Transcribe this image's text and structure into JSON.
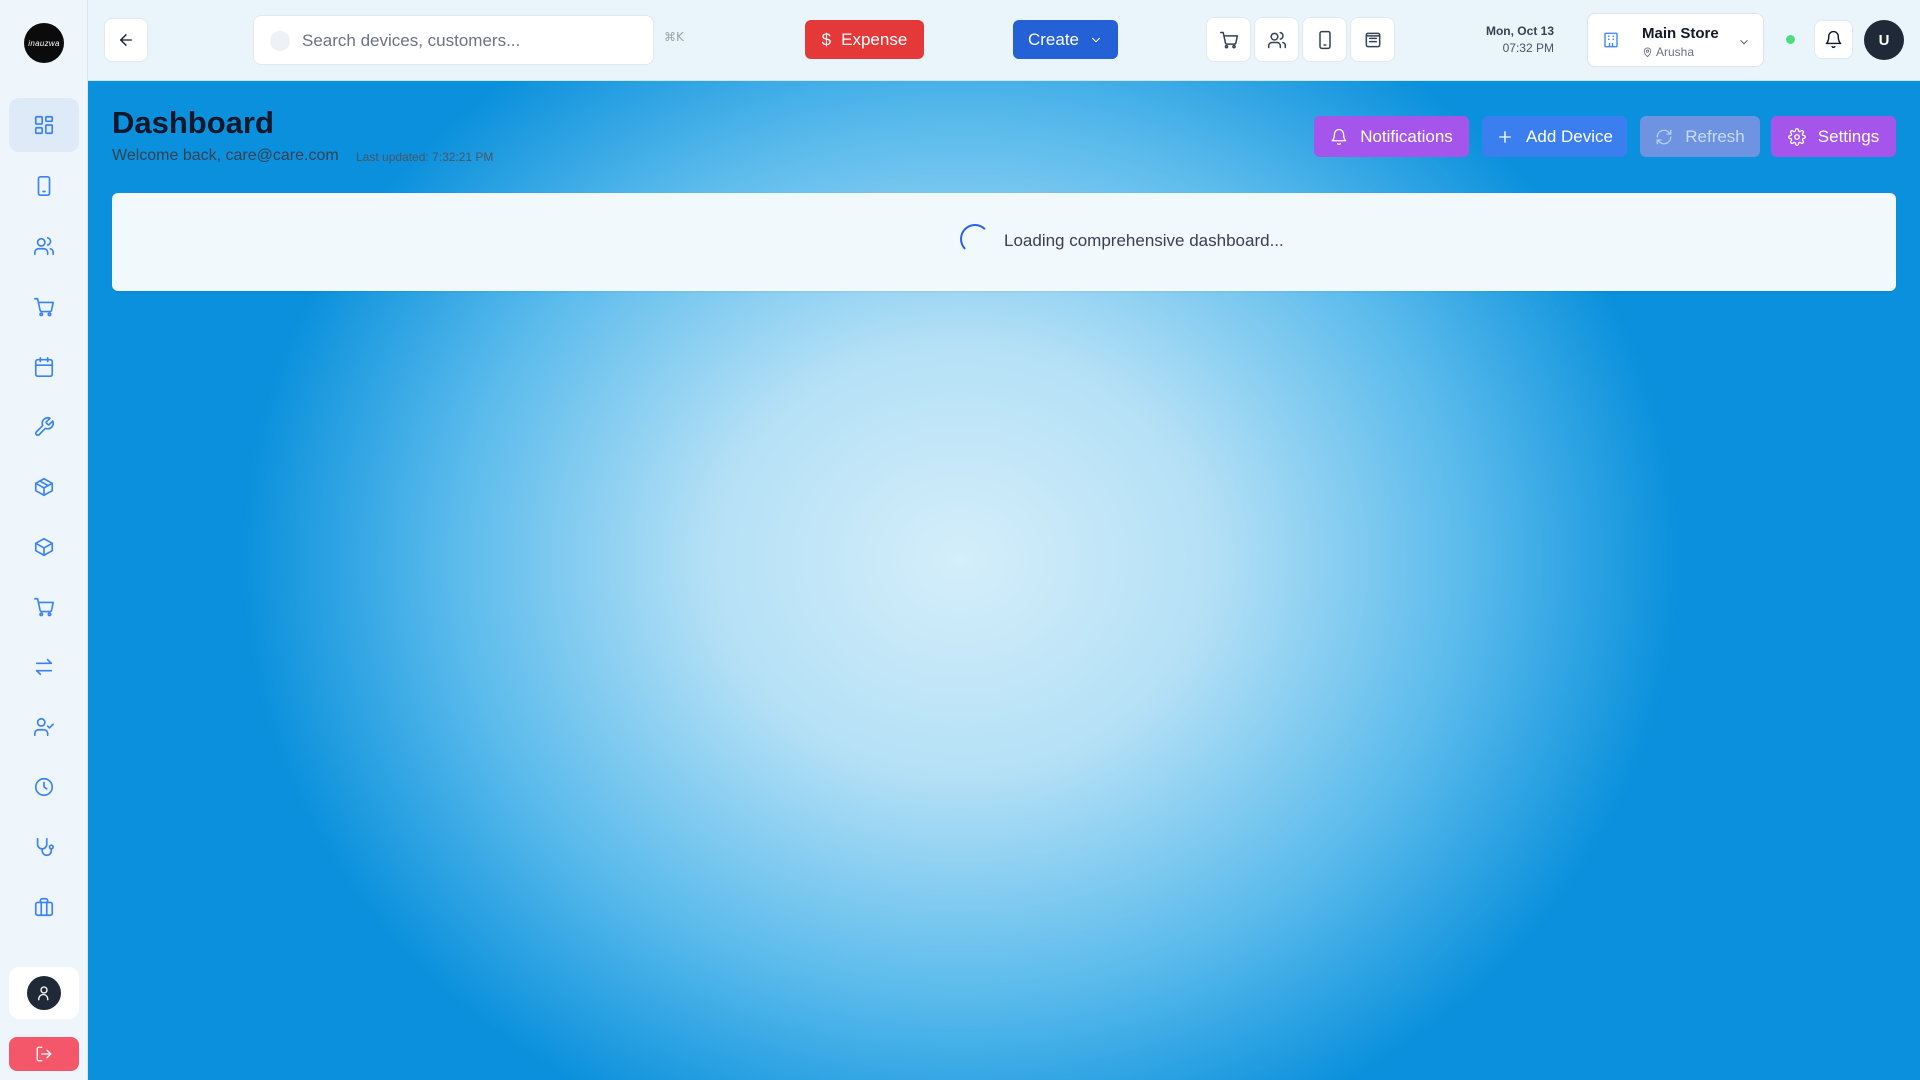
{
  "app": {
    "logo_text": "inauzwa",
    "page_title": "Dashboard",
    "welcome_text": "Welcome back, care@care.com",
    "last_updated": "Last updated: 7:32:21 PM"
  },
  "sidebar": {
    "items": [
      {
        "name": "dashboard",
        "icon": "grid-icon",
        "active": true
      },
      {
        "name": "devices",
        "icon": "phone-icon"
      },
      {
        "name": "customers",
        "icon": "users-icon"
      },
      {
        "name": "sales",
        "icon": "cart-icon"
      },
      {
        "name": "calendar",
        "icon": "calendar-icon"
      },
      {
        "name": "repairs",
        "icon": "wrench-icon"
      },
      {
        "name": "inventory",
        "icon": "box-icon"
      },
      {
        "name": "products",
        "icon": "package-icon"
      },
      {
        "name": "purchases",
        "icon": "cart-icon"
      },
      {
        "name": "transfers",
        "icon": "arrows-icon"
      },
      {
        "name": "employees",
        "icon": "user-check-icon"
      },
      {
        "name": "history",
        "icon": "clock-icon"
      },
      {
        "name": "diagnostics",
        "icon": "stethoscope-icon"
      },
      {
        "name": "business",
        "icon": "briefcase-icon"
      }
    ],
    "user_icon": "user-icon",
    "logout_icon": "logout-icon"
  },
  "topbar": {
    "search_placeholder": "Search devices, customers...",
    "shortcut": "⌘K",
    "expense_label": "Expense",
    "create_label": "Create",
    "quick_actions": [
      "cart-icon",
      "users-icon",
      "phone-icon",
      "archive-icon"
    ],
    "date": "Mon, Oct 13",
    "time": "07:32 PM",
    "store_name": "Main Store",
    "store_location": "Arusha",
    "avatar_initial": "U"
  },
  "actions": {
    "notifications": "Notifications",
    "add_device": "Add Device",
    "refresh": "Refresh",
    "settings": "Settings"
  },
  "loading": {
    "text": "Loading comprehensive dashboard..."
  },
  "colors": {
    "expense": "#e53838",
    "create": "#2460d6",
    "purple": "#a655ec",
    "blue": "#3b7ef0",
    "status_online": "#4ade80",
    "logout": "#f4566a"
  }
}
